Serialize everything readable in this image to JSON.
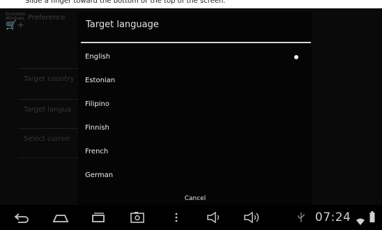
{
  "caption": "Slide a finger toward the bottom or the top of the screen.",
  "background_app": {
    "logo_small_text": "Economic Windows",
    "logo_big_text": "+",
    "title": "Preference",
    "items": [
      "Target country",
      "Target langua",
      "Select curren"
    ]
  },
  "dialog": {
    "title": "Target language",
    "options": [
      {
        "label": "English",
        "selected": true
      },
      {
        "label": "Estonian",
        "selected": false
      },
      {
        "label": "Filipino",
        "selected": false
      },
      {
        "label": "Finnish",
        "selected": false
      },
      {
        "label": "French",
        "selected": false
      },
      {
        "label": "German",
        "selected": false
      }
    ],
    "cancel_label": "Cancel"
  },
  "status": {
    "time": "07:24"
  },
  "colors": {
    "screen_background": "#0a0a0a",
    "dialog_background": "#050505",
    "text": "#efefef",
    "icon": "#c8c8c8"
  }
}
